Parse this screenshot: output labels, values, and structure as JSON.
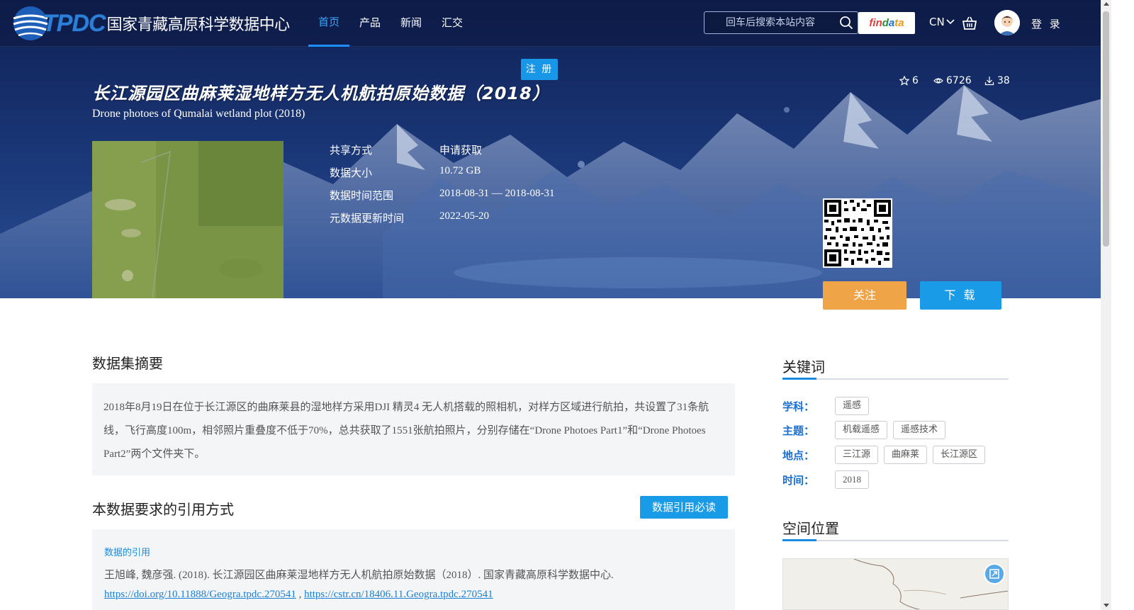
{
  "header": {
    "logo_text": "TPDC",
    "site_name": "国家青藏高原科学数据中心",
    "nav": [
      {
        "label": "首页",
        "active": true
      },
      {
        "label": "产品",
        "active": false
      },
      {
        "label": "新闻",
        "active": false
      },
      {
        "label": "汇交",
        "active": false
      }
    ],
    "search_placeholder": "回车后搜索本站内容",
    "findata_label": [
      "fin",
      "d",
      "a",
      "ta"
    ],
    "lang": "CN",
    "login": "登 录",
    "register": "注 册"
  },
  "dataset": {
    "title_cn": "长江源园区曲麻莱湿地样方无人机航拍原始数据（2018）",
    "title_en": "Drone photoes of Qumalai wetland plot (2018)",
    "stats": {
      "stars": "6",
      "views": "6726",
      "downloads": "38"
    },
    "info": [
      {
        "key": "共享方式",
        "value": "申请获取"
      },
      {
        "key": "数据大小",
        "value": "10.72 GB"
      },
      {
        "key": "数据时间范围",
        "value": "2018-08-31 — 2018-08-31"
      },
      {
        "key": "元数据更新时间",
        "value": "2022-05-20"
      }
    ],
    "follow_label": "关注",
    "download_label": "下 载"
  },
  "abstract": {
    "heading": "数据集摘要",
    "text": "2018年8月19日在位于长江源区的曲麻莱县的湿地样方采用DJI 精灵4 无人机搭载的照相机，对样方区域进行航拍，共设置了31条航线，飞行高度100m，相邻照片重叠度不低于70%，总共获取了1551张航拍照片，分别存储在“Drone Photoes Part1”和“Drone Photoes Part2”两个文件夹下。"
  },
  "citation": {
    "heading": "本数据要求的引用方式",
    "must_read": "数据引用必读",
    "label": "数据的引用",
    "text": "王旭峰, 魏彦强. (2018). 长江源园区曲麻莱湿地样方无人机航拍原始数据（2018）. 国家青藏高原科学数据中心.",
    "doi": "https://doi.org/10.11888/Geogra.tpdc.270541",
    "cstr": "https://cstr.cn/18406.11.Geogra.tpdc.270541"
  },
  "keywords": {
    "heading": "关键词",
    "rows": [
      {
        "label": "学科：",
        "tags": [
          "遥感"
        ]
      },
      {
        "label": "主题：",
        "tags": [
          "机载遥感",
          "遥感技术"
        ]
      },
      {
        "label": "地点：",
        "tags": [
          "三江源",
          "曲麻莱",
          "长江源区"
        ]
      },
      {
        "label": "时间：",
        "tags": [
          "2018"
        ]
      }
    ]
  },
  "spatial": {
    "heading": "空间位置"
  },
  "colors": {
    "accent": "#1a9be8",
    "follow": "#f0a448",
    "keyword_label": "#1a6fd0"
  }
}
